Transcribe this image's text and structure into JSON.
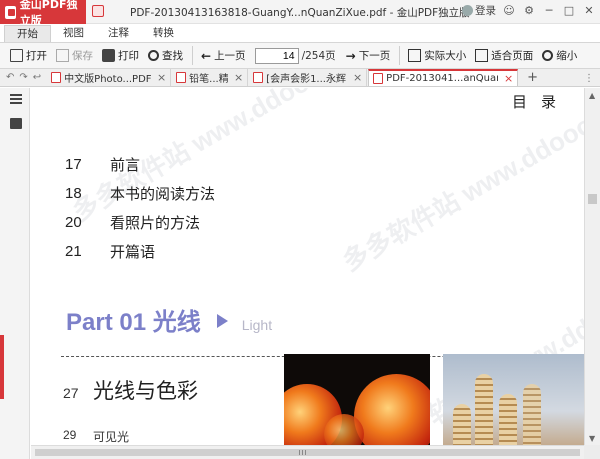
{
  "app": {
    "brand": "金山PDF独立版",
    "window_title": "PDF-20130413163818-GuangY...nQuanZiXue.pdf - 金山PDF独立版",
    "login": "登录"
  },
  "ribbon": {
    "tabs": [
      "开始",
      "视图",
      "注释",
      "转换"
    ],
    "active_tab": "开始"
  },
  "toolbar": {
    "open": "打开",
    "save": "保存",
    "print": "打印",
    "find": "查找",
    "prev_page": "上一页",
    "current_page": "14",
    "total_pages": "/254页",
    "next_page": "下一页",
    "actual_size": "实际大小",
    "fit_page": "适合页面",
    "zoom_out": "缩小"
  },
  "doc_tabs": [
    {
      "label": "中文版Photo...PDF电子书]",
      "active": false
    },
    {
      "label": "铅笔...精通",
      "active": false
    },
    {
      "label": "[会声会影1...永辉.扫描版",
      "active": false
    },
    {
      "label": "PDF-2013041...anQuanZiXue",
      "active": true
    }
  ],
  "page": {
    "heading": "目录",
    "toc": [
      {
        "num": "17",
        "title": "前言"
      },
      {
        "num": "18",
        "title": "本书的阅读方法"
      },
      {
        "num": "20",
        "title": "看照片的方法"
      },
      {
        "num": "21",
        "title": "开篇语"
      }
    ],
    "part_title": "Part 01 光线",
    "part_subtitle": "Light",
    "chapter": {
      "num": "27",
      "title": "光线与色彩"
    },
    "section": {
      "num": "29",
      "title": "可见光"
    },
    "watermark": "多多软件站 www.ddooo.com"
  },
  "colors": {
    "brand_red": "#d7373a",
    "part_purple": "#7c80c9"
  }
}
